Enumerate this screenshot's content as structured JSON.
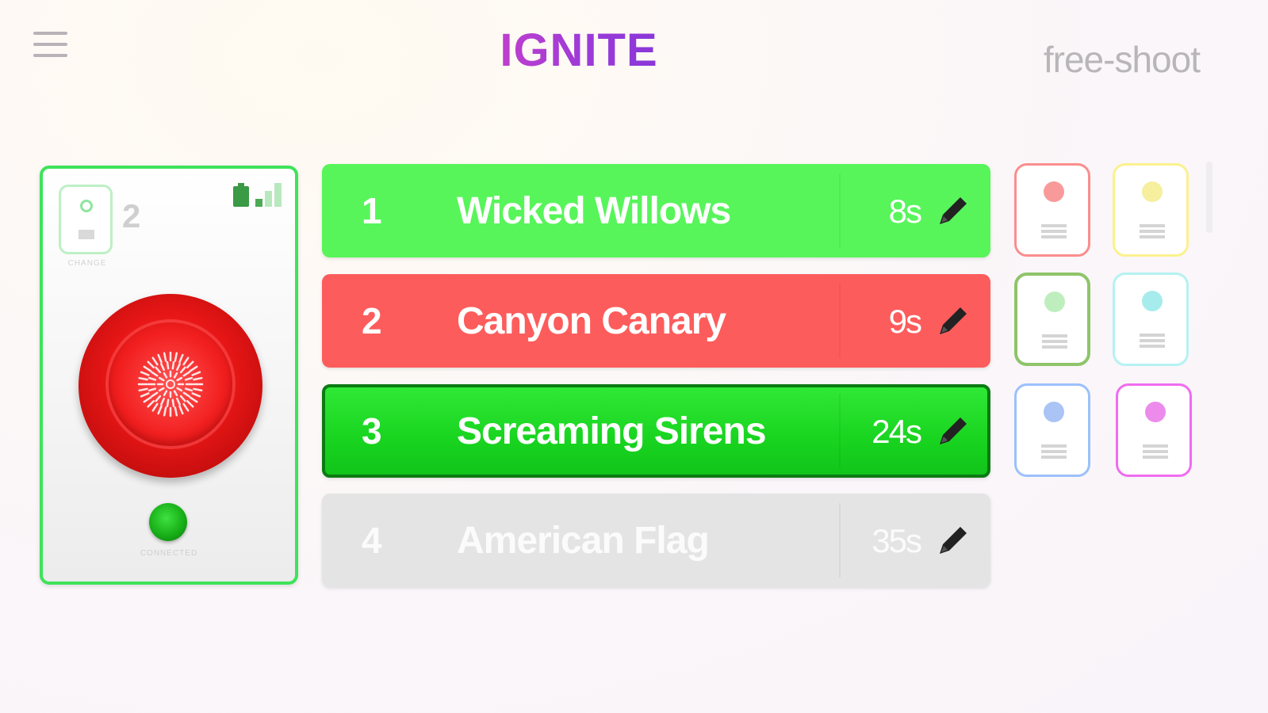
{
  "header": {
    "logo_text": "IGNITE",
    "mode_label": "free-shoot"
  },
  "controller": {
    "channel_number": "2",
    "channel_caption": "CHANGE",
    "status_caption": "CONNECTED",
    "border_color": "#3ee35a"
  },
  "sequences": [
    {
      "number": "1",
      "name": "Wicked Willows",
      "duration": "8s",
      "color": "#57f55a"
    },
    {
      "number": "2",
      "name": "Canyon Canary",
      "duration": "9s",
      "color": "#fd5c5c"
    },
    {
      "number": "3",
      "name": "Screaming Sirens",
      "duration": "24s",
      "color": "#18d41f",
      "active": true
    },
    {
      "number": "4",
      "name": "American Flag",
      "duration": "35s",
      "color": "#e4e4e4",
      "disabled": true
    }
  ],
  "channel_tiles": [
    {
      "color": "#fb8d8d",
      "dot": "#f99a9a"
    },
    {
      "color": "#fbf18e",
      "dot": "#f5ef9e"
    },
    {
      "color": "#8ec46a",
      "dot": "#bfeebe",
      "selected": true
    },
    {
      "color": "#b5f2f2",
      "dot": "#a7ecec"
    },
    {
      "color": "#9cc0fb",
      "dot": "#a9c4f5"
    },
    {
      "color": "#f06cf0",
      "dot": "#ec8bec"
    }
  ],
  "icons": {
    "menu": "hamburger-icon",
    "edit": "pencil-icon",
    "fire": "firework-burst-icon",
    "battery": "battery-icon",
    "signal": "signal-icon"
  }
}
